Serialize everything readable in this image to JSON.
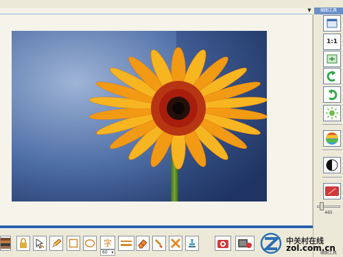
{
  "top": {
    "menu_arrow": "▼",
    "panel_title": "缩图工具"
  },
  "right_panel": {
    "fit_label": "1:1",
    "slider_value": "465",
    "footer_label": "缩图工具"
  },
  "bottom_toolbar": {
    "text_tool_char": "字",
    "font_size_value": "60",
    "font_size_arrow": "▾"
  },
  "watermark": {
    "brand": "中关村在线",
    "url": "zol.com.cn"
  },
  "colors": {
    "accent_blue": "#2a5fae",
    "tool_green": "#34a84a",
    "tool_red": "#d0393b",
    "flower_orange": "#f4a21a"
  }
}
